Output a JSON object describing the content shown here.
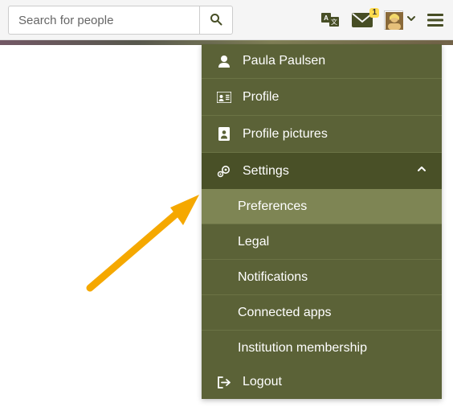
{
  "header": {
    "search_placeholder": "Search for people",
    "inbox_count": "1"
  },
  "menu": {
    "user_name": "Paula Paulsen",
    "profile": "Profile",
    "pictures": "Profile pictures",
    "settings": "Settings",
    "sub": {
      "preferences": "Preferences",
      "legal": "Legal",
      "notifications": "Notifications",
      "connected_apps": "Connected apps",
      "institution_membership": "Institution membership"
    },
    "logout": "Logout"
  }
}
